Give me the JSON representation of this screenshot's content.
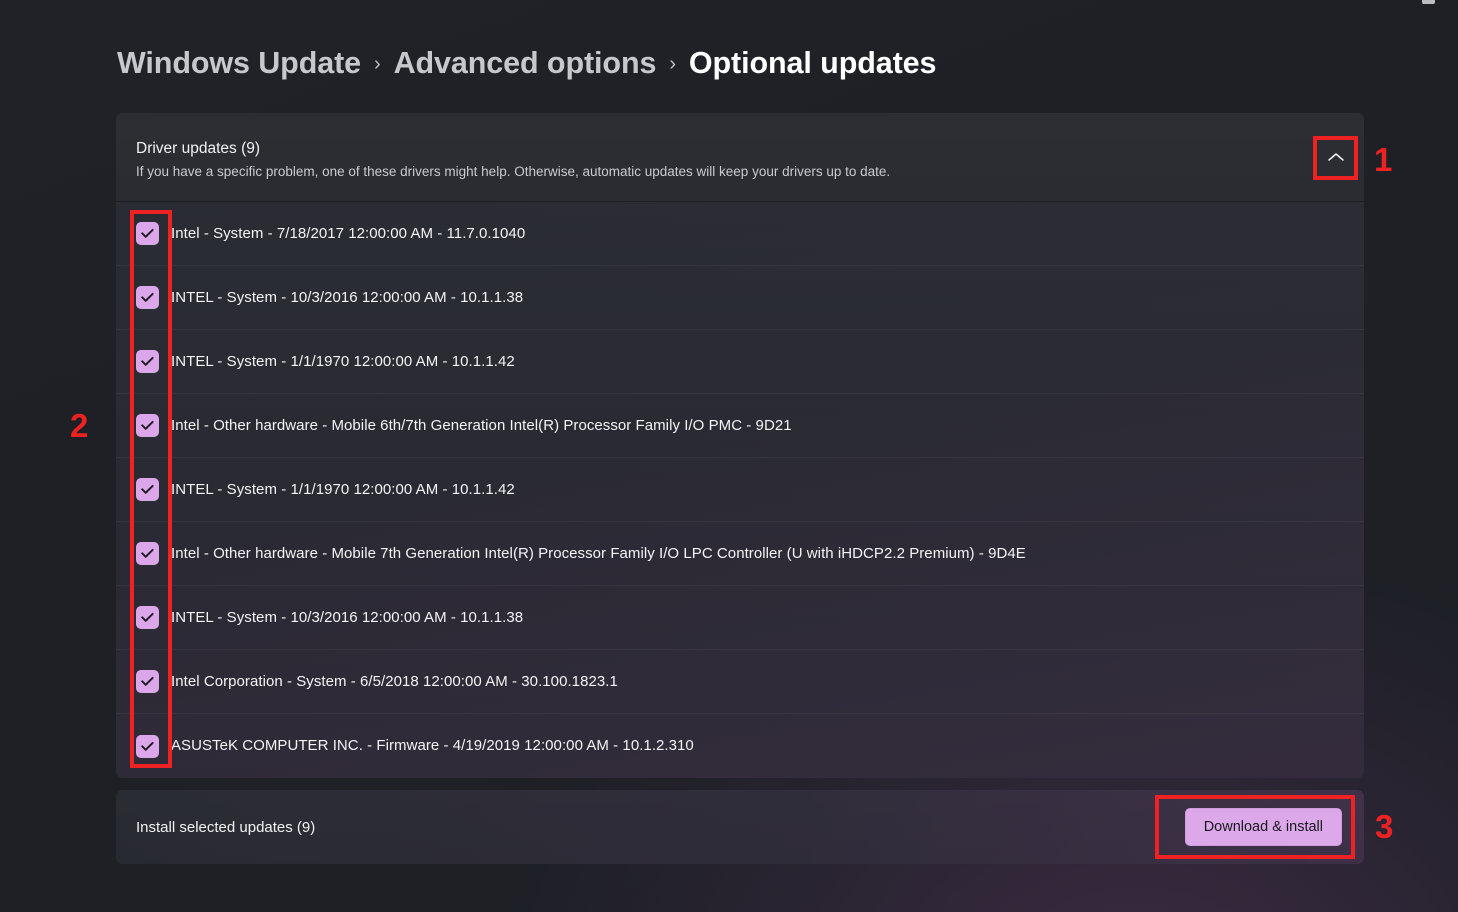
{
  "breadcrumb": {
    "items": [
      {
        "label": "Windows Update",
        "current": false
      },
      {
        "label": "Advanced options",
        "current": false
      },
      {
        "label": "Optional updates",
        "current": true
      }
    ],
    "separator": "›"
  },
  "card": {
    "title": "Driver updates (9)",
    "description": "If you have a specific problem, one of these drivers might help. Otherwise, automatic updates will keep your drivers up to date.",
    "collapse_icon": "chevron-up-icon",
    "expanded": true
  },
  "updates": [
    {
      "label": "Intel - System - 7/18/2017 12:00:00 AM - 11.7.0.1040",
      "checked": true
    },
    {
      "label": "INTEL - System - 10/3/2016 12:00:00 AM - 10.1.1.38",
      "checked": true
    },
    {
      "label": "INTEL - System - 1/1/1970 12:00:00 AM - 10.1.1.42",
      "checked": true
    },
    {
      "label": "Intel - Other hardware - Mobile 6th/7th Generation Intel(R) Processor Family I/O PMC - 9D21",
      "checked": true
    },
    {
      "label": "INTEL - System - 1/1/1970 12:00:00 AM - 10.1.1.42",
      "checked": true
    },
    {
      "label": "Intel - Other hardware - Mobile 7th Generation Intel(R) Processor Family I/O LPC Controller (U with iHDCP2.2 Premium) - 9D4E",
      "checked": true
    },
    {
      "label": "INTEL - System - 10/3/2016 12:00:00 AM - 10.1.1.38",
      "checked": true
    },
    {
      "label": "Intel Corporation - System - 6/5/2018 12:00:00 AM - 30.100.1823.1",
      "checked": true
    },
    {
      "label": "ASUSTeK COMPUTER INC. - Firmware - 4/19/2019 12:00:00 AM - 10.1.2.310",
      "checked": true
    }
  ],
  "footer": {
    "summary": "Install selected updates (9)",
    "button_label": "Download & install"
  },
  "annotations": [
    {
      "number": "1",
      "target": "collapse-button"
    },
    {
      "number": "2",
      "target": "checkbox-column"
    },
    {
      "number": "3",
      "target": "download-install-button"
    }
  ],
  "colors": {
    "accent_checkbox": "#dca7ea",
    "accent_button": "#dda8ea",
    "annotation_red": "#ee2222",
    "page_background": "#202124",
    "card_background": "#2a2c32"
  }
}
